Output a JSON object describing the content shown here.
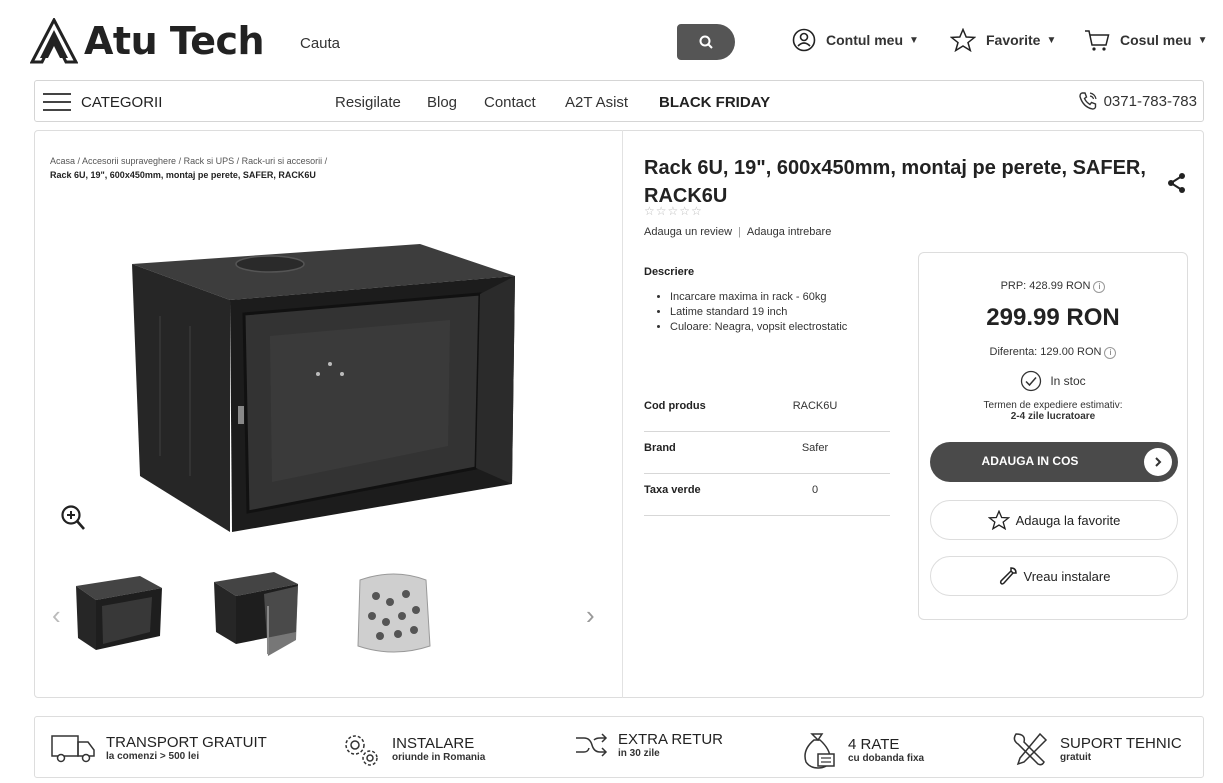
{
  "header": {
    "logo_text": "Atu Tech",
    "search_placeholder": "Cauta",
    "account_label": "Contul meu",
    "favorites_label": "Favorite",
    "cart_label": "Cosul meu"
  },
  "nav": {
    "categories_label": "CATEGORII",
    "links": [
      "Resigilate",
      "Blog",
      "Contact",
      "A2T Asist",
      "BLACK FRIDAY"
    ],
    "phone": "0371-783-783"
  },
  "breadcrumb": {
    "path": "Acasa / Accesorii supraveghere / Rack si UPS / Rack-uri si accesorii /",
    "current": "Rack 6U, 19\", 600x450mm, montaj pe perete, SAFER, RACK6U"
  },
  "product": {
    "title": "Rack 6U, 19\", 600x450mm, montaj pe perete, SAFER, RACK6U",
    "stars": "☆☆☆☆☆",
    "add_review": "Adauga un review",
    "add_question": "Adauga intrebare",
    "description_title": "Descriere",
    "description_items": [
      "Incarcare maxima in rack - 60kg",
      "Latime standard 19 inch",
      "Culoare: Neagra, vopsit electrostatic"
    ],
    "specs": [
      {
        "key": "Cod produs",
        "value": "RACK6U"
      },
      {
        "key": "Brand",
        "value": "Safer"
      },
      {
        "key": "Taxa verde",
        "value": "0"
      }
    ]
  },
  "pricing": {
    "prp": "PRP: 428.99 RON",
    "price": "299.99 RON",
    "difference": "Diferenta: 129.00 RON",
    "stock": "In stoc",
    "shipping_label": "Termen de expediere estimativ:",
    "shipping_value": "2-4 zile lucratoare",
    "add_to_cart": "ADAUGA IN COS",
    "add_favorite": "Adauga la favorite",
    "want_install": "Vreau instalare"
  },
  "features": [
    {
      "title": "TRANSPORT GRATUIT",
      "sub": "la comenzi > 500 lei",
      "icon": "truck-icon"
    },
    {
      "title": "INSTALARE",
      "sub": "oriunde in Romania",
      "icon": "gears-icon"
    },
    {
      "title": "EXTRA RETUR",
      "sub": "in 30 zile",
      "icon": "shuffle-icon"
    },
    {
      "title": "4 RATE",
      "sub": "cu dobanda fixa",
      "icon": "money-bag-icon"
    },
    {
      "title": "SUPORT TEHNIC",
      "sub": "gratuit",
      "icon": "tools-icon"
    }
  ],
  "colors": {
    "accent_dark": "#4a4a4a",
    "text": "#222222",
    "border": "#dddddd"
  }
}
